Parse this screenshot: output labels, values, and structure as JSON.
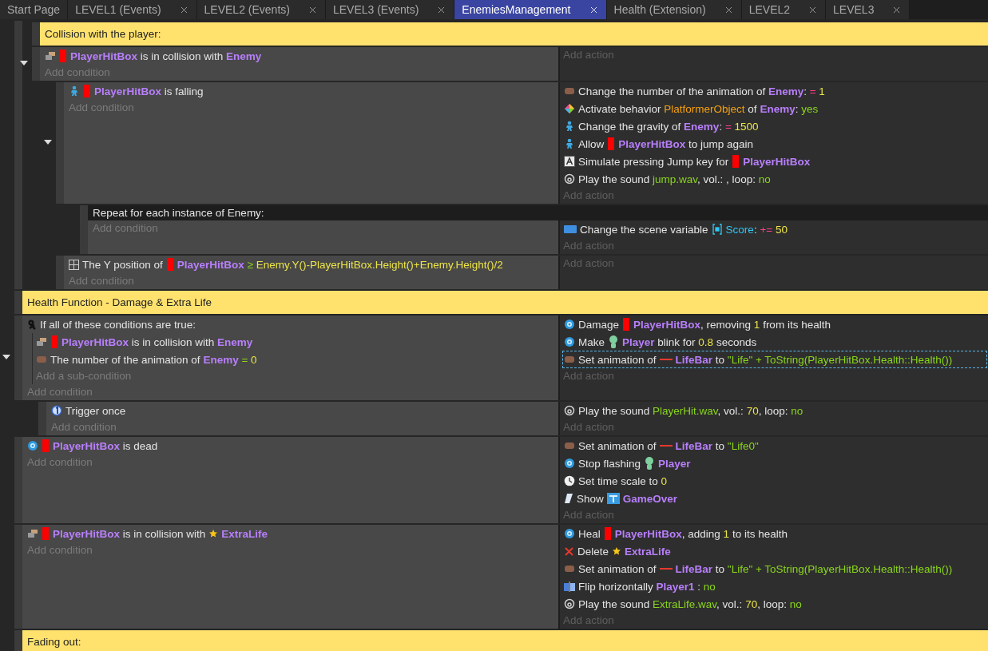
{
  "tabs": [
    {
      "label": "Start Page",
      "selected": false,
      "closable": false
    },
    {
      "label": "LEVEL1 (Events)",
      "selected": false,
      "closable": true
    },
    {
      "label": "LEVEL2 (Events)",
      "selected": false,
      "closable": true
    },
    {
      "label": "LEVEL3 (Events)",
      "selected": false,
      "closable": true
    },
    {
      "label": "EnemiesManagement",
      "selected": true,
      "closable": true
    },
    {
      "label": "Health (Extension)",
      "selected": false,
      "closable": true
    },
    {
      "label": "LEVEL2",
      "selected": false,
      "closable": true
    },
    {
      "label": "LEVEL3",
      "selected": false,
      "closable": true
    }
  ],
  "events": [
    {
      "kind": "continuation",
      "children": [
        {
          "kind": "comment",
          "text": "Collision with the player:"
        },
        {
          "kind": "standard",
          "expanded": true,
          "add_condition": "Add condition",
          "add_action": "Add action",
          "conditions": [
            {
              "parts": [
                {
                  "kind": "collision"
                },
                {
                  "kind": "hitbox"
                },
                {
                  "kind": "text",
                  "runs": [
                    {
                      "kind": "obj",
                      "text": "PlayerHitBox"
                    },
                    {
                      "kind": "plain",
                      "text": " is in collision with "
                    },
                    {
                      "kind": "obj",
                      "text": "Enemy"
                    }
                  ]
                }
              ]
            }
          ],
          "children": [
            {
              "kind": "standard",
              "expanded": true,
              "add_condition": "Add condition",
              "add_action": "Add action",
              "conditions": [
                {
                  "parts": [
                    {
                      "kind": "platformer"
                    },
                    {
                      "kind": "hitbox"
                    },
                    {
                      "kind": "text",
                      "runs": [
                        {
                          "kind": "obj",
                          "text": "PlayerHitBox"
                        },
                        {
                          "kind": "plain",
                          "text": " is falling"
                        }
                      ]
                    }
                  ]
                }
              ],
              "actions": [
                {
                  "selected": false,
                  "parts": [
                    {
                      "kind": "sprite"
                    },
                    {
                      "kind": "text",
                      "runs": [
                        {
                          "kind": "plain",
                          "text": "Change the number of the animation of "
                        },
                        {
                          "kind": "obj",
                          "text": "Enemy"
                        },
                        {
                          "kind": "plain",
                          "text": ": "
                        },
                        {
                          "kind": "op",
                          "text": "="
                        },
                        {
                          "kind": "num",
                          "text": " 1"
                        }
                      ]
                    }
                  ]
                },
                {
                  "selected": false,
                  "parts": [
                    {
                      "kind": "behavior"
                    },
                    {
                      "kind": "text",
                      "runs": [
                        {
                          "kind": "plain",
                          "text": "Activate behavior "
                        },
                        {
                          "kind": "beh",
                          "text": "PlatformerObject"
                        },
                        {
                          "kind": "plain",
                          "text": " of "
                        },
                        {
                          "kind": "obj",
                          "text": "Enemy"
                        },
                        {
                          "kind": "plain",
                          "text": ": "
                        },
                        {
                          "kind": "str",
                          "text": "yes"
                        }
                      ]
                    }
                  ]
                },
                {
                  "selected": false,
                  "parts": [
                    {
                      "kind": "platformer"
                    },
                    {
                      "kind": "text",
                      "runs": [
                        {
                          "kind": "plain",
                          "text": "Change the gravity of "
                        },
                        {
                          "kind": "obj",
                          "text": "Enemy"
                        },
                        {
                          "kind": "plain",
                          "text": ": "
                        },
                        {
                          "kind": "op",
                          "text": "="
                        },
                        {
                          "kind": "num",
                          "text": " 1500"
                        }
                      ]
                    }
                  ]
                },
                {
                  "selected": false,
                  "parts": [
                    {
                      "kind": "platformer"
                    },
                    {
                      "kind": "text",
                      "runs": [
                        {
                          "kind": "plain",
                          "text": "Allow"
                        }
                      ]
                    },
                    {
                      "kind": "hitbox"
                    },
                    {
                      "kind": "text",
                      "runs": [
                        {
                          "kind": "obj",
                          "text": "PlayerHitBox"
                        },
                        {
                          "kind": "plain",
                          "text": " to jump again"
                        }
                      ]
                    }
                  ]
                },
                {
                  "selected": false,
                  "parts": [
                    {
                      "kind": "key"
                    },
                    {
                      "kind": "text",
                      "runs": [
                        {
                          "kind": "plain",
                          "text": "Simulate pressing Jump key for"
                        }
                      ]
                    },
                    {
                      "kind": "hitbox"
                    },
                    {
                      "kind": "text",
                      "runs": [
                        {
                          "kind": "obj",
                          "text": "PlayerHitBox"
                        }
                      ]
                    }
                  ]
                },
                {
                  "selected": false,
                  "parts": [
                    {
                      "kind": "sound"
                    },
                    {
                      "kind": "text",
                      "runs": [
                        {
                          "kind": "plain",
                          "text": "Play the sound "
                        },
                        {
                          "kind": "str",
                          "text": "jump.wav"
                        },
                        {
                          "kind": "plain",
                          "text": ", vol.: , loop: "
                        },
                        {
                          "kind": "str",
                          "text": "no"
                        }
                      ]
                    }
                  ]
                }
              ],
              "children": [
                {
                  "kind": "repeat",
                  "header": "Repeat for each instance of Enemy:",
                  "add_condition": "Add condition",
                  "add_action": "Add action",
                  "actions": [
                    {
                      "selected": false,
                      "parts": [
                        {
                          "kind": "variable"
                        },
                        {
                          "kind": "text",
                          "runs": [
                            {
                              "kind": "plain",
                              "text": "Change the scene variable"
                            }
                          ]
                        },
                        {
                          "kind": "varbrace"
                        },
                        {
                          "kind": "text",
                          "runs": [
                            {
                              "kind": "var",
                              "text": "Score"
                            },
                            {
                              "kind": "plain",
                              "text": ": "
                            },
                            {
                              "kind": "op",
                              "text": "+="
                            },
                            {
                              "kind": "num",
                              "text": " 50"
                            }
                          ]
                        }
                      ]
                    }
                  ]
                }
              ]
            },
            {
              "kind": "standard",
              "add_condition": "Add condition",
              "add_action": "Add action",
              "conditions": [
                {
                  "parts": [
                    {
                      "kind": "position"
                    },
                    {
                      "kind": "text",
                      "runs": [
                        {
                          "kind": "plain",
                          "text": "The Y position of"
                        }
                      ]
                    },
                    {
                      "kind": "hitbox"
                    },
                    {
                      "kind": "text",
                      "runs": [
                        {
                          "kind": "obj",
                          "text": "PlayerHitBox"
                        },
                        {
                          "kind": "opg",
                          "text": " ≥"
                        },
                        {
                          "kind": "num",
                          "text": " Enemy.Y()-PlayerHitBox.Height()+Enemy.Height()/2"
                        }
                      ]
                    }
                  ]
                }
              ]
            }
          ]
        }
      ]
    },
    {
      "kind": "comment",
      "text": "Health Function - Damage & Extra Life"
    },
    {
      "kind": "standard",
      "expanded": true,
      "add_condition": "Add condition",
      "add_action": "Add action",
      "conditions": [
        {
          "parts": [
            {
              "kind": "and"
            },
            {
              "kind": "text",
              "runs": [
                {
                  "kind": "plain",
                  "text": "If all of these conditions are true:"
                }
              ]
            }
          ],
          "add_subcondition": "Add a sub-condition",
          "subconditions": [
            {
              "parts": [
                {
                  "kind": "collision"
                },
                {
                  "kind": "hitbox"
                },
                {
                  "kind": "text",
                  "runs": [
                    {
                      "kind": "obj",
                      "text": "PlayerHitBox"
                    },
                    {
                      "kind": "plain",
                      "text": " is in collision with "
                    },
                    {
                      "kind": "obj",
                      "text": "Enemy"
                    }
                  ]
                }
              ]
            },
            {
              "parts": [
                {
                  "kind": "sprite"
                },
                {
                  "kind": "text",
                  "runs": [
                    {
                      "kind": "plain",
                      "text": "The number of the animation of "
                    },
                    {
                      "kind": "obj",
                      "text": "Enemy"
                    },
                    {
                      "kind": "opg",
                      "text": " ="
                    },
                    {
                      "kind": "num",
                      "text": " 0"
                    }
                  ]
                }
              ]
            }
          ]
        }
      ],
      "actions": [
        {
          "selected": false,
          "parts": [
            {
              "kind": "health"
            },
            {
              "kind": "text",
              "runs": [
                {
                  "kind": "plain",
                  "text": "Damage"
                }
              ]
            },
            {
              "kind": "hitbox"
            },
            {
              "kind": "text",
              "runs": [
                {
                  "kind": "obj",
                  "text": "PlayerHitBox"
                },
                {
                  "kind": "plain",
                  "text": ", removing "
                },
                {
                  "kind": "num",
                  "text": "1"
                },
                {
                  "kind": "plain",
                  "text": " from its health"
                }
              ]
            }
          ]
        },
        {
          "selected": false,
          "parts": [
            {
              "kind": "health"
            },
            {
              "kind": "text",
              "runs": [
                {
                  "kind": "plain",
                  "text": "Make"
                }
              ]
            },
            {
              "kind": "player"
            },
            {
              "kind": "text",
              "runs": [
                {
                  "kind": "obj",
                  "text": "Player"
                },
                {
                  "kind": "plain",
                  "text": " blink for "
                },
                {
                  "kind": "num",
                  "text": "0.8"
                },
                {
                  "kind": "plain",
                  "text": " seconds"
                }
              ]
            }
          ]
        },
        {
          "selected": true,
          "parts": [
            {
              "kind": "sprite"
            },
            {
              "kind": "text",
              "runs": [
                {
                  "kind": "plain",
                  "text": "Set animation of"
                }
              ]
            },
            {
              "kind": "lifebar"
            },
            {
              "kind": "text",
              "runs": [
                {
                  "kind": "obj",
                  "text": "LifeBar"
                },
                {
                  "kind": "plain",
                  "text": " to "
                },
                {
                  "kind": "str",
                  "text": "\"Life\" + ToString(PlayerHitBox.Health::Health())"
                }
              ]
            }
          ]
        }
      ],
      "children": [
        {
          "kind": "standard",
          "add_condition": "Add condition",
          "add_action": "Add action",
          "conditions": [
            {
              "parts": [
                {
                  "kind": "trigger"
                },
                {
                  "kind": "text",
                  "runs": [
                    {
                      "kind": "plain",
                      "text": "Trigger once"
                    }
                  ]
                }
              ]
            }
          ],
          "actions": [
            {
              "selected": false,
              "parts": [
                {
                  "kind": "sound"
                },
                {
                  "kind": "text",
                  "runs": [
                    {
                      "kind": "plain",
                      "text": "Play the sound "
                    },
                    {
                      "kind": "str",
                      "text": "PlayerHit.wav"
                    },
                    {
                      "kind": "plain",
                      "text": ", vol.: "
                    },
                    {
                      "kind": "num",
                      "text": "70"
                    },
                    {
                      "kind": "plain",
                      "text": ", loop: "
                    },
                    {
                      "kind": "str",
                      "text": "no"
                    }
                  ]
                }
              ]
            }
          ]
        }
      ]
    },
    {
      "kind": "standard",
      "add_condition": "Add condition",
      "add_action": "Add action",
      "conditions": [
        {
          "parts": [
            {
              "kind": "health"
            },
            {
              "kind": "hitbox"
            },
            {
              "kind": "text",
              "runs": [
                {
                  "kind": "obj",
                  "text": "PlayerHitBox"
                },
                {
                  "kind": "plain",
                  "text": " is dead"
                }
              ]
            }
          ]
        }
      ],
      "actions": [
        {
          "selected": false,
          "parts": [
            {
              "kind": "sprite"
            },
            {
              "kind": "text",
              "runs": [
                {
                  "kind": "plain",
                  "text": "Set animation of"
                }
              ]
            },
            {
              "kind": "lifebar"
            },
            {
              "kind": "text",
              "runs": [
                {
                  "kind": "obj",
                  "text": "LifeBar"
                },
                {
                  "kind": "plain",
                  "text": " to "
                },
                {
                  "kind": "str",
                  "text": "\"Life0\""
                }
              ]
            }
          ]
        },
        {
          "selected": false,
          "parts": [
            {
              "kind": "health"
            },
            {
              "kind": "text",
              "runs": [
                {
                  "kind": "plain",
                  "text": "Stop flashing"
                }
              ]
            },
            {
              "kind": "player"
            },
            {
              "kind": "text",
              "runs": [
                {
                  "kind": "obj",
                  "text": "Player"
                }
              ]
            }
          ]
        },
        {
          "selected": false,
          "parts": [
            {
              "kind": "clock"
            },
            {
              "kind": "text",
              "runs": [
                {
                  "kind": "plain",
                  "text": "Set time scale to "
                },
                {
                  "kind": "num",
                  "text": "0"
                }
              ]
            }
          ]
        },
        {
          "selected": false,
          "parts": [
            {
              "kind": "visibility"
            },
            {
              "kind": "text",
              "runs": [
                {
                  "kind": "plain",
                  "text": "Show"
                }
              ]
            },
            {
              "kind": "textobj"
            },
            {
              "kind": "text",
              "runs": [
                {
                  "kind": "obj",
                  "text": "GameOver"
                }
              ]
            }
          ]
        }
      ]
    },
    {
      "kind": "standard",
      "add_condition": "Add condition",
      "add_action": "Add action",
      "conditions": [
        {
          "parts": [
            {
              "kind": "collision"
            },
            {
              "kind": "hitbox"
            },
            {
              "kind": "text",
              "runs": [
                {
                  "kind": "obj",
                  "text": "PlayerHitBox"
                },
                {
                  "kind": "plain",
                  "text": " is in collision with"
                }
              ]
            },
            {
              "kind": "star"
            },
            {
              "kind": "text",
              "runs": [
                {
                  "kind": "obj",
                  "text": "ExtraLife"
                }
              ]
            }
          ]
        }
      ],
      "actions": [
        {
          "selected": false,
          "parts": [
            {
              "kind": "health"
            },
            {
              "kind": "text",
              "runs": [
                {
                  "kind": "plain",
                  "text": "Heal"
                }
              ]
            },
            {
              "kind": "hitbox"
            },
            {
              "kind": "text",
              "runs": [
                {
                  "kind": "obj",
                  "text": "PlayerHitBox"
                },
                {
                  "kind": "plain",
                  "text": ", adding "
                },
                {
                  "kind": "num",
                  "text": "1"
                },
                {
                  "kind": "plain",
                  "text": " to its health"
                }
              ]
            }
          ]
        },
        {
          "selected": false,
          "parts": [
            {
              "kind": "delete"
            },
            {
              "kind": "text",
              "runs": [
                {
                  "kind": "plain",
                  "text": "Delete"
                }
              ]
            },
            {
              "kind": "star"
            },
            {
              "kind": "text",
              "runs": [
                {
                  "kind": "obj",
                  "text": "ExtraLife"
                }
              ]
            }
          ]
        },
        {
          "selected": false,
          "parts": [
            {
              "kind": "sprite"
            },
            {
              "kind": "text",
              "runs": [
                {
                  "kind": "plain",
                  "text": "Set animation of"
                }
              ]
            },
            {
              "kind": "lifebar"
            },
            {
              "kind": "text",
              "runs": [
                {
                  "kind": "obj",
                  "text": "LifeBar"
                },
                {
                  "kind": "plain",
                  "text": " to "
                },
                {
                  "kind": "str",
                  "text": "\"Life\" + ToString(PlayerHitBox.Health::Health())"
                }
              ]
            }
          ]
        },
        {
          "selected": false,
          "parts": [
            {
              "kind": "flip"
            },
            {
              "kind": "text",
              "runs": [
                {
                  "kind": "plain",
                  "text": "Flip horizontally "
                },
                {
                  "kind": "obj",
                  "text": "Player1"
                },
                {
                  "kind": "plain",
                  "text": " : "
                },
                {
                  "kind": "str",
                  "text": "no"
                }
              ]
            }
          ]
        },
        {
          "selected": false,
          "parts": [
            {
              "kind": "sound"
            },
            {
              "kind": "text",
              "runs": [
                {
                  "kind": "plain",
                  "text": "Play the sound "
                },
                {
                  "kind": "str",
                  "text": "ExtraLife.wav"
                },
                {
                  "kind": "plain",
                  "text": ", vol.: "
                },
                {
                  "kind": "num",
                  "text": "70"
                },
                {
                  "kind": "plain",
                  "text": ", loop: "
                },
                {
                  "kind": "str",
                  "text": "no"
                }
              ]
            }
          ]
        }
      ]
    },
    {
      "kind": "comment",
      "text": "Fading out:"
    }
  ]
}
